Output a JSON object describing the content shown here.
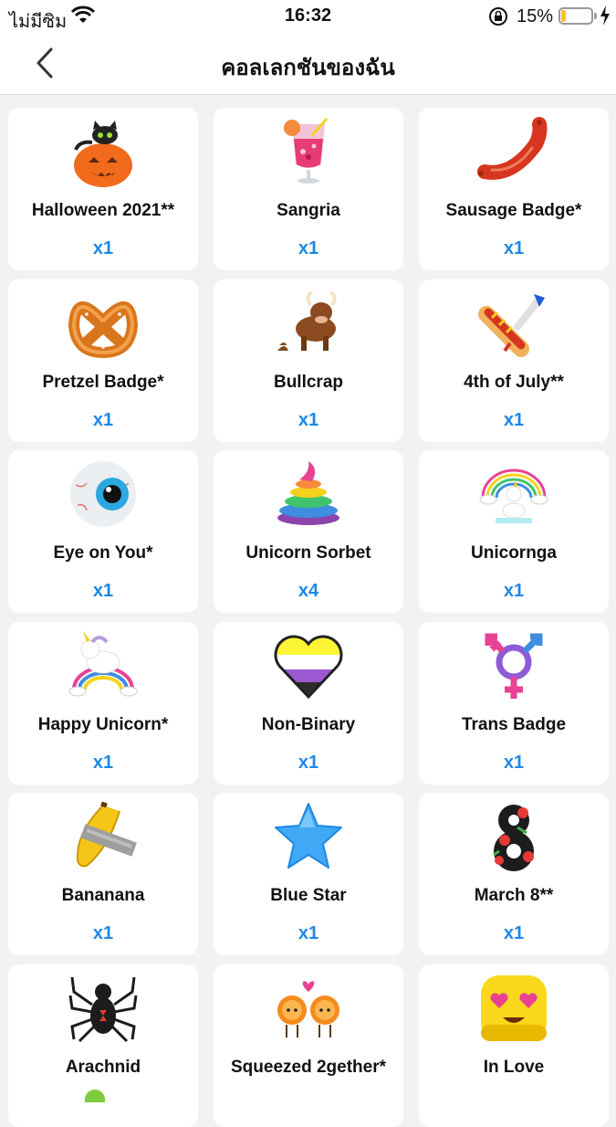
{
  "status_bar": {
    "carrier": "ไม่มีซิม",
    "time": "16:32",
    "battery_percent": "15%",
    "battery_level": 0.15
  },
  "header": {
    "title": "คอลเลกชันของฉัน"
  },
  "items": [
    {
      "name": "Halloween 2021**",
      "count": "x1",
      "icon": "pumpkin-cat-icon"
    },
    {
      "name": "Sangria",
      "count": "x1",
      "icon": "sangria-glass-icon"
    },
    {
      "name": "Sausage Badge*",
      "count": "x1",
      "icon": "sausage-icon"
    },
    {
      "name": "Pretzel Badge*",
      "count": "x1",
      "icon": "pretzel-icon"
    },
    {
      "name": "Bullcrap",
      "count": "x1",
      "icon": "bull-icon"
    },
    {
      "name": "4th of July**",
      "count": "x1",
      "icon": "hotdog-rocket-icon"
    },
    {
      "name": "Eye on You*",
      "count": "x1",
      "icon": "eyeball-icon"
    },
    {
      "name": "Unicorn Sorbet",
      "count": "x4",
      "icon": "rainbow-poop-icon"
    },
    {
      "name": "Unicornga",
      "count": "x1",
      "icon": "yoga-unicorn-icon"
    },
    {
      "name": "Happy Unicorn*",
      "count": "x1",
      "icon": "happy-unicorn-icon"
    },
    {
      "name": "Non-Binary",
      "count": "x1",
      "icon": "nonbinary-heart-icon"
    },
    {
      "name": "Trans Badge",
      "count": "x1",
      "icon": "trans-symbol-icon"
    },
    {
      "name": "Banana­na",
      "count": "x1",
      "icon": "taped-banana-icon"
    },
    {
      "name": "Blue Star",
      "count": "x1",
      "icon": "blue-star-icon"
    },
    {
      "name": "March 8**",
      "count": "x1",
      "icon": "march-eight-icon"
    },
    {
      "name": "Arachnid",
      "count": "",
      "icon": "spider-icon"
    },
    {
      "name": "Squeezed 2gether*",
      "count": "",
      "icon": "orange-couple-icon"
    },
    {
      "name": "In Love",
      "count": "",
      "icon": "heart-eyes-icon"
    }
  ]
}
